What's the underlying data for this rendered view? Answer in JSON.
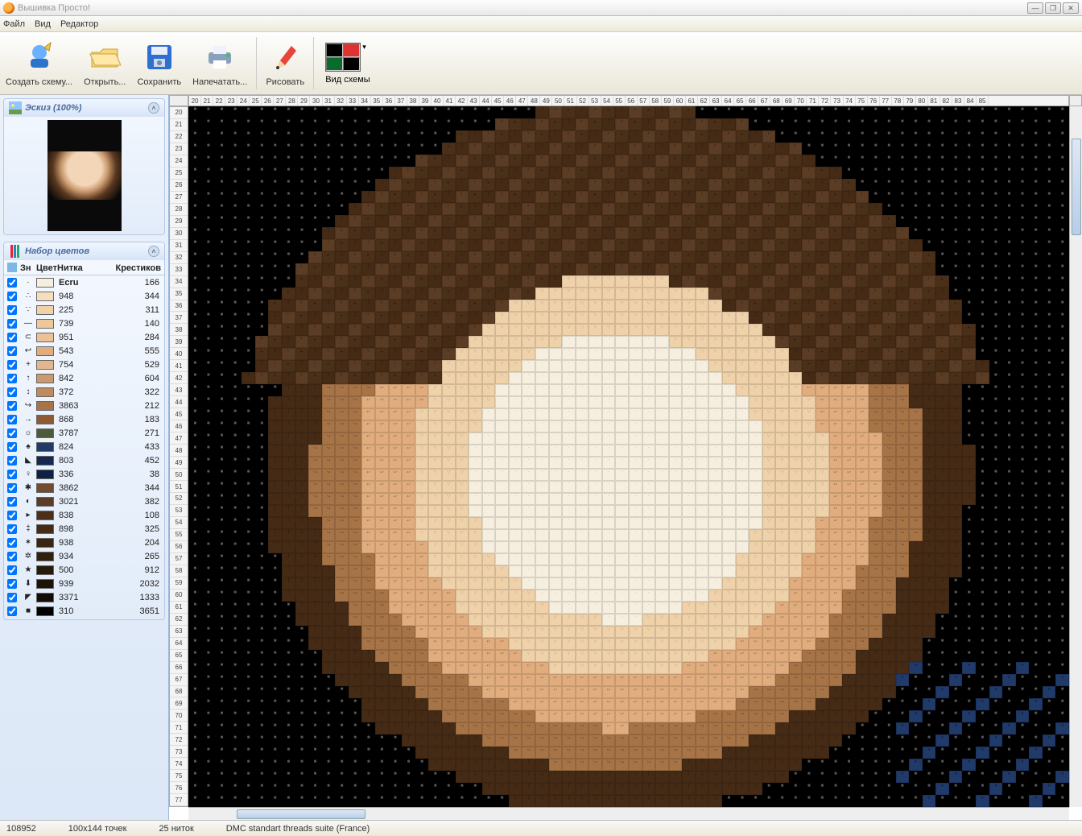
{
  "window": {
    "title": "Вышивка Просто!"
  },
  "menu": {
    "file": "Файл",
    "view": "Вид",
    "editor": "Редактор"
  },
  "toolbar": {
    "create": "Создать схему...",
    "open": "Открыть...",
    "save": "Сохранить",
    "print": "Напечатать...",
    "draw": "Рисовать",
    "viewmode": "Вид схемы"
  },
  "panels": {
    "thumb_title": "Эскиз (100%)",
    "colors_title": "Набор цветов",
    "head_chk": "",
    "head_sym": "Зн",
    "head_color": "Цвет",
    "head_thread": "Нитка",
    "head_cross": "Крестиков"
  },
  "colors": [
    {
      "sym": "·",
      "hex": "#f6efdf",
      "thr": "Ecru",
      "cnt": 166
    },
    {
      "sym": "∴",
      "hex": "#f5dec0",
      "thr": "948",
      "cnt": 344
    },
    {
      "sym": "∵",
      "hex": "#f0d2aa",
      "thr": "225",
      "cnt": 311
    },
    {
      "sym": "—",
      "hex": "#efc89a",
      "thr": "739",
      "cnt": 140
    },
    {
      "sym": "⊂",
      "hex": "#eec095",
      "thr": "951",
      "cnt": 284
    },
    {
      "sym": "↩",
      "hex": "#e1ad7e",
      "thr": "543",
      "cnt": 555
    },
    {
      "sym": "+",
      "hex": "#e2b78d",
      "thr": "754",
      "cnt": 529
    },
    {
      "sym": "↑",
      "hex": "#c99a6e",
      "thr": "842",
      "cnt": 604
    },
    {
      "sym": "↕",
      "hex": "#bc8b5e",
      "thr": "372",
      "cnt": 322
    },
    {
      "sym": "↪",
      "hex": "#a77447",
      "thr": "3863",
      "cnt": 212
    },
    {
      "sym": "→",
      "hex": "#8e5a33",
      "thr": "868",
      "cnt": 183
    },
    {
      "sym": "☼",
      "hex": "#4d5b3a",
      "thr": "3787",
      "cnt": 271
    },
    {
      "sym": "♠",
      "hex": "#203a6a",
      "thr": "824",
      "cnt": 433
    },
    {
      "sym": "◣",
      "hex": "#16284f",
      "thr": "803",
      "cnt": 452
    },
    {
      "sym": "♀",
      "hex": "#0f2142",
      "thr": "336",
      "cnt": 38
    },
    {
      "sym": "✱",
      "hex": "#734c2f",
      "thr": "3862",
      "cnt": 344
    },
    {
      "sym": "◐",
      "hex": "#5b3c24",
      "thr": "3021",
      "cnt": 382
    },
    {
      "sym": "▸",
      "hex": "#4a3019",
      "thr": "838",
      "cnt": 108
    },
    {
      "sym": "‡",
      "hex": "#452b15",
      "thr": "898",
      "cnt": 325
    },
    {
      "sym": "✶",
      "hex": "#3a2412",
      "thr": "938",
      "cnt": 204
    },
    {
      "sym": "✲",
      "hex": "#32200f",
      "thr": "934",
      "cnt": 265
    },
    {
      "sym": "★",
      "hex": "#261a0b",
      "thr": "500",
      "cnt": 912
    },
    {
      "sym": "⬇",
      "hex": "#1c1408",
      "thr": "939",
      "cnt": 2032
    },
    {
      "sym": "◤",
      "hex": "#130d06",
      "thr": "3371",
      "cnt": 1333
    },
    {
      "sym": "■",
      "hex": "#000000",
      "thr": "310",
      "cnt": 3651
    }
  ],
  "grid": {
    "colStart": 20,
    "colEnd": 85,
    "rowStart": 20,
    "rowEnd": 77
  },
  "status": {
    "id": "108952",
    "size": "100x144 точек",
    "threads": "25 ниток",
    "suite": "DMC standart threads suite (France)"
  }
}
